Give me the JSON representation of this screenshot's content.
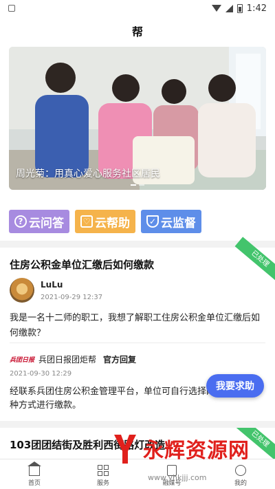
{
  "status_bar": {
    "time": "1:42"
  },
  "header": {
    "title": "帮"
  },
  "banner": {
    "caption": "周光菊：用真心爱心服务社区居民"
  },
  "quick_actions": [
    {
      "label": "云问答",
      "icon": "question-icon",
      "color": "#a78be0"
    },
    {
      "label": "云帮助",
      "icon": "handshake-icon",
      "color": "#f5b34b"
    },
    {
      "label": "云监督",
      "icon": "shield-icon",
      "color": "#5e8ee9"
    }
  ],
  "cards": [
    {
      "status": "已处理",
      "title": "住房公积金单位汇缴后如何缴款",
      "user": {
        "name": "LuLu",
        "time": "2021-09-29 12:37"
      },
      "question": "我是一名十二师的职工，我想了解职工住房公积金单位汇缴后如何缴款？",
      "reply": {
        "source_logo": "兵团日报",
        "source": "兵团日报团炬帮",
        "badge": "官方回复",
        "time": "2021-09-30 12:29"
      },
      "answer": "经联系兵团住房公积金管理平台，单位可自行选择网银、支票三种方式进行缴款。"
    },
    {
      "status": "已处理",
      "title": "103团团结街及胜利西街路灯改造"
    }
  ],
  "fab": {
    "label": "我要求助"
  },
  "bottom_nav": [
    {
      "label": "首页",
      "icon": "home-icon"
    },
    {
      "label": "服务",
      "icon": "grid-icon"
    },
    {
      "label": "融媒号",
      "icon": "doc-icon"
    },
    {
      "label": "我的",
      "icon": "me-icon"
    }
  ],
  "watermark": {
    "text": "永辉资源网",
    "url": "www.yhkjjj.com"
  }
}
